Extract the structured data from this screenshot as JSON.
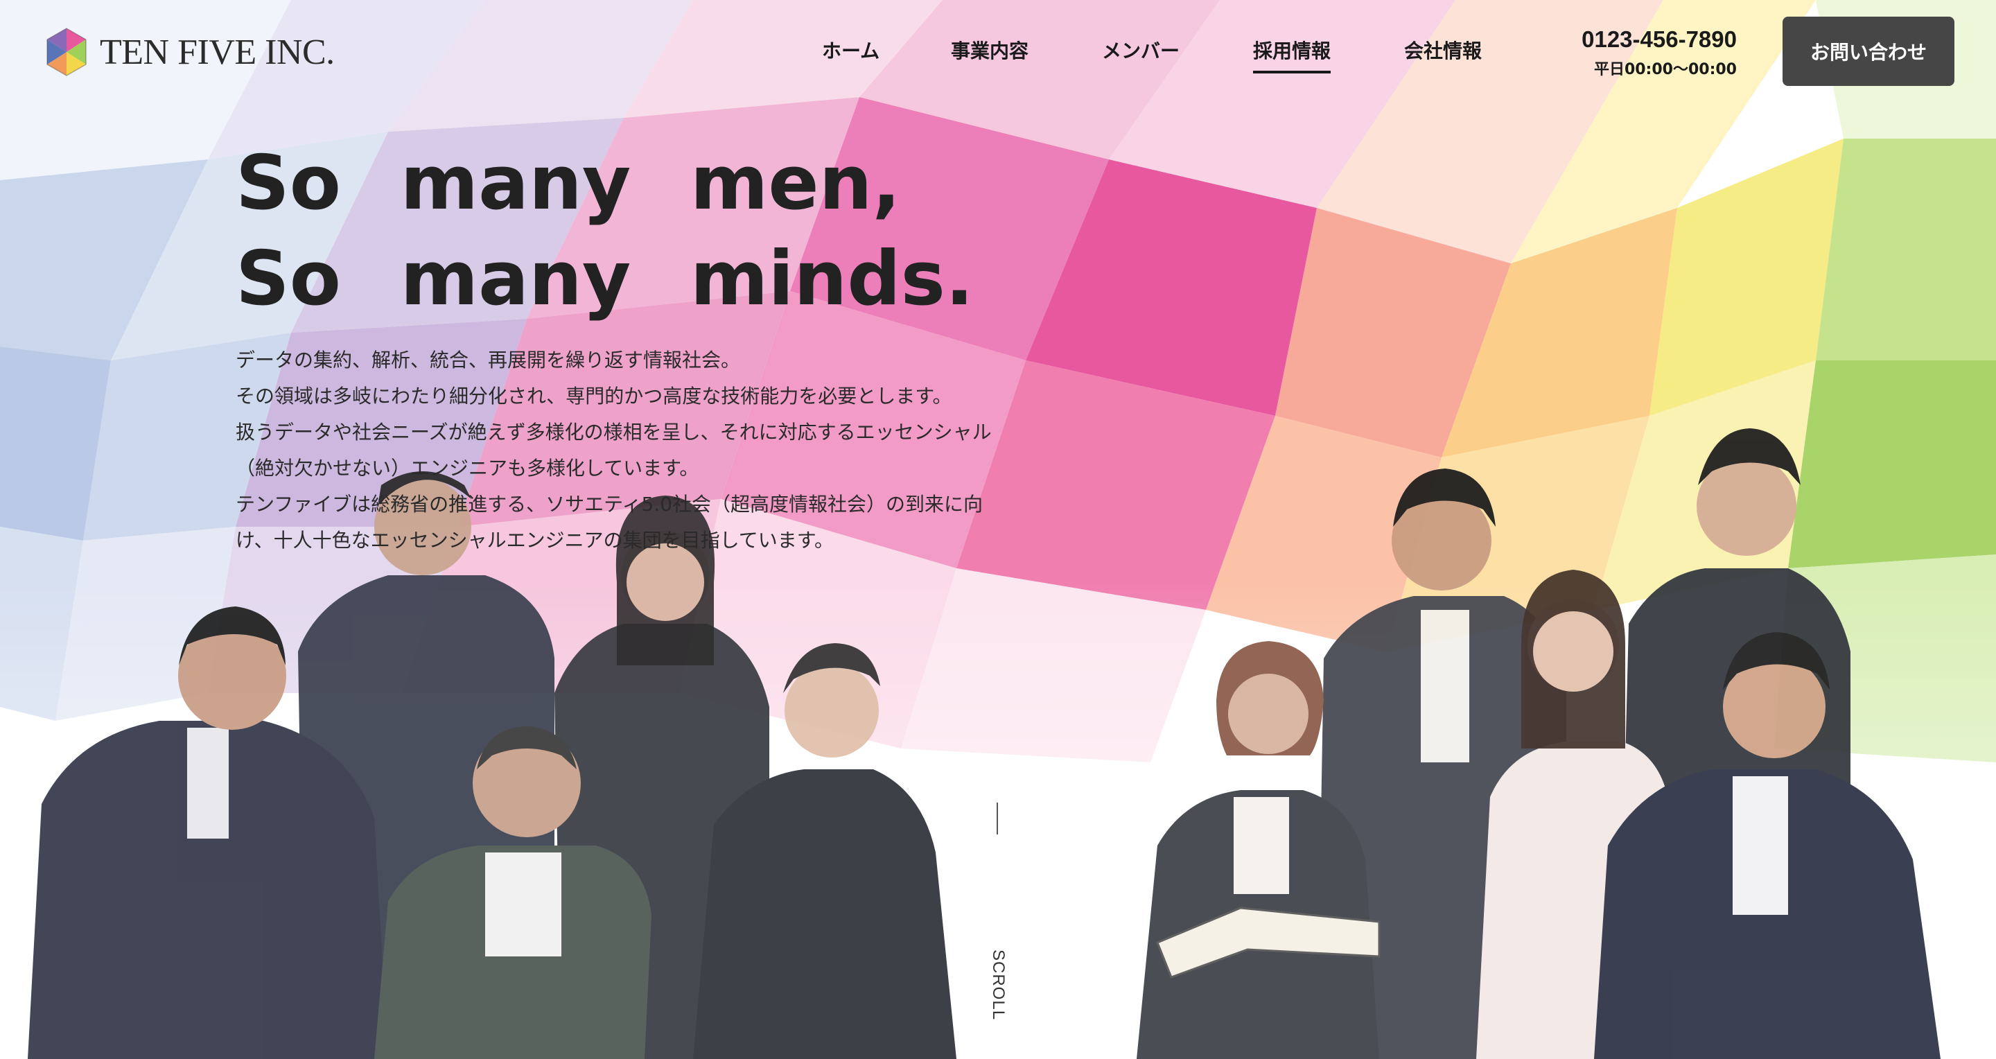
{
  "brand": {
    "name": "TEN FIVE INC."
  },
  "nav": {
    "items": [
      {
        "label": "ホーム",
        "active": false
      },
      {
        "label": "事業内容",
        "active": false
      },
      {
        "label": "メンバー",
        "active": false
      },
      {
        "label": "採用情報",
        "active": true
      },
      {
        "label": "会社情報",
        "active": false
      }
    ]
  },
  "contact": {
    "phone": "0123-456-7890",
    "hours": "平日00:00〜00:00",
    "button_label": "お問い合わせ"
  },
  "hero": {
    "title_line1": "So many men,",
    "title_line2": "So many minds.",
    "body": [
      "データの集約、解析、統合、再展開を繰り返す情報社会。",
      "その領域は多岐にわたり細分化され、専門的かつ高度な技術能力を必要とします。",
      "扱うデータや社会ニーズが絶えず多様化の様相を呈し、それに対応するエッセンシャル",
      "（絶対欠かせない）エンジニアも多様化しています。",
      "テンファイブは総務省の推進する、ソサエティ5.0社会（超高度情報社会）の到来に向",
      "け、十人十色なエッセンシャルエンジニアの集団を目指しています。"
    ]
  },
  "scroll": {
    "label": "SCROLL"
  },
  "colors": {
    "cta_bg": "#464646",
    "text": "#222222",
    "accent_pink": "#e85aa6",
    "accent_blue": "#8aa7d6",
    "accent_green": "#9fd05a",
    "accent_yellow": "#f3e66a"
  }
}
